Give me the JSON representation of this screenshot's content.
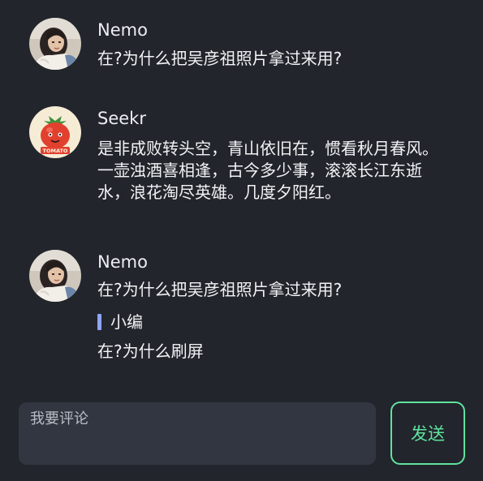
{
  "messages": [
    {
      "user": "Nemo",
      "avatar_icon": "user-photo-avatar",
      "text": "在?为什么把吴彦祖照片拿过来用?"
    },
    {
      "user": "Seekr",
      "avatar_icon": "tomato-avatar",
      "avatar_label": "TOMATO",
      "lines": [
        "是非成败转头空，青山依旧在，惯看秋月春风。",
        "一壶浊酒喜相逢，古今多少事，滚滚长江东逝",
        "水，浪花淘尽英雄。几度夕阳红。"
      ]
    },
    {
      "user": "Nemo",
      "avatar_icon": "user-photo-avatar",
      "text": "在?为什么把吴彦祖照片拿过来用?",
      "quote": {
        "name": "小编",
        "text": "在?为什么刷屏"
      }
    }
  ],
  "composer": {
    "placeholder": "我要评论",
    "value": "",
    "send_label": "发送"
  },
  "colors": {
    "background": "#22252c",
    "input_background": "#323640",
    "accent": "#5fe39e",
    "quote_bar": "#8ea4ff"
  }
}
